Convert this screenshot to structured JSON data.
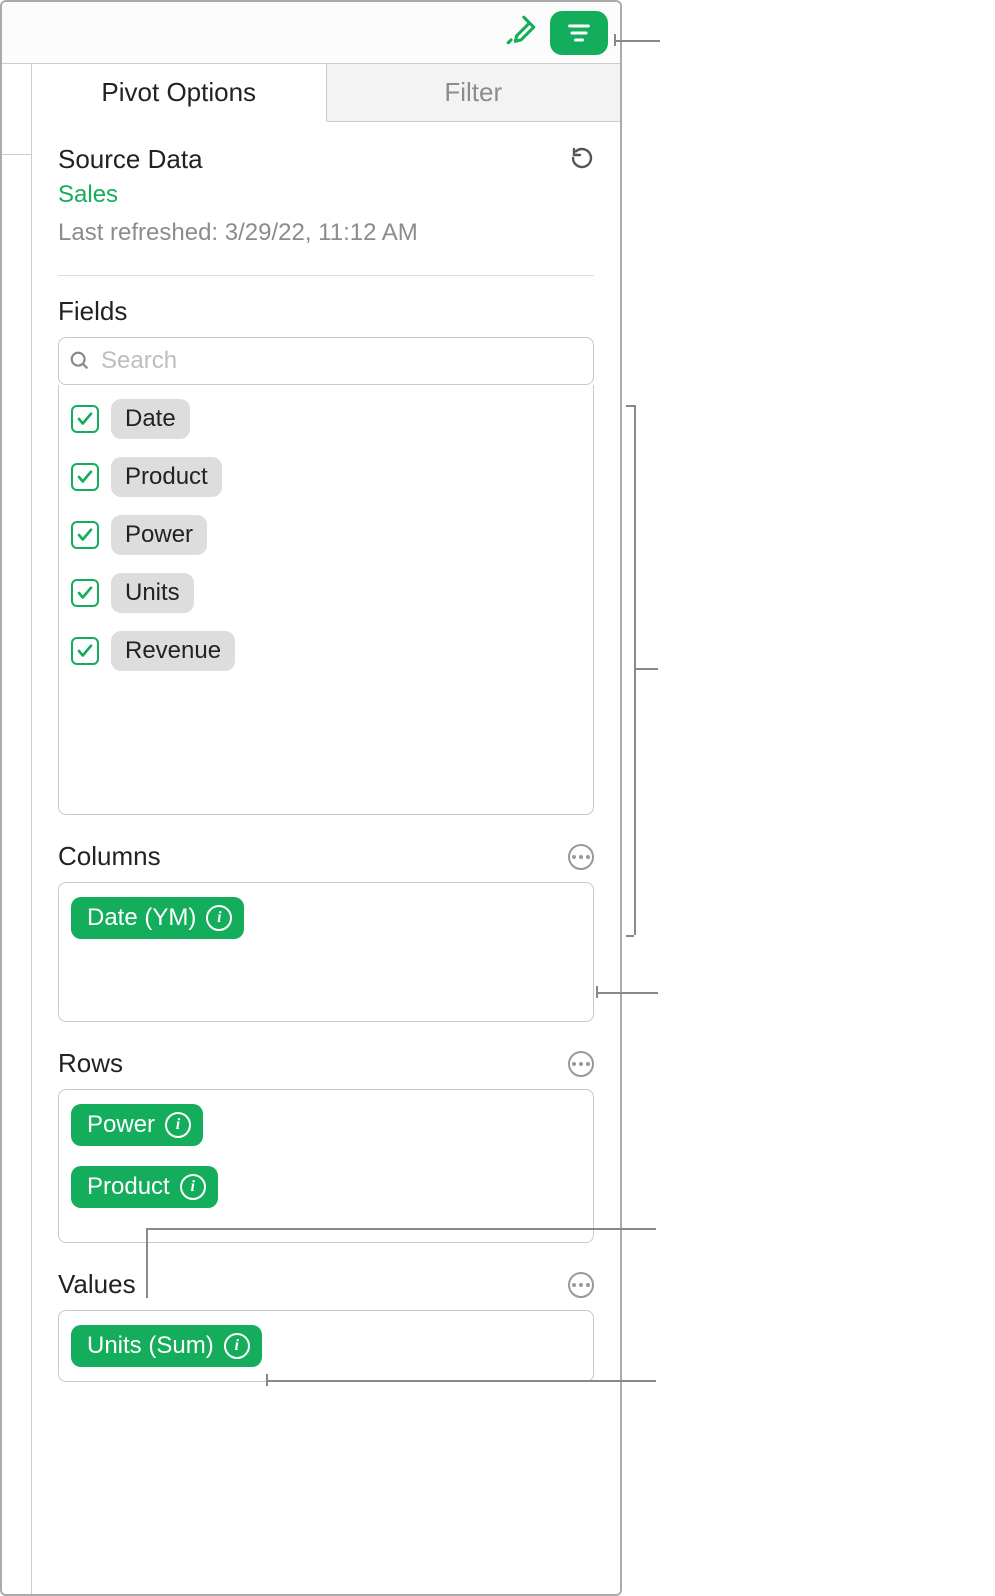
{
  "tabs": {
    "pivot": "Pivot Options",
    "filter": "Filter"
  },
  "source": {
    "heading": "Source Data",
    "name": "Sales",
    "refreshed": "Last refreshed: 3/29/22, 11:12 AM"
  },
  "fields": {
    "heading": "Fields",
    "search_placeholder": "Search",
    "items": [
      {
        "label": "Date",
        "checked": true
      },
      {
        "label": "Product",
        "checked": true
      },
      {
        "label": "Power",
        "checked": true
      },
      {
        "label": "Units",
        "checked": true
      },
      {
        "label": "Revenue",
        "checked": true
      }
    ]
  },
  "columns": {
    "heading": "Columns",
    "items": [
      {
        "label": "Date (YM)"
      }
    ]
  },
  "rows": {
    "heading": "Rows",
    "items": [
      {
        "label": "Power"
      },
      {
        "label": "Product"
      }
    ]
  },
  "values": {
    "heading": "Values",
    "items": [
      {
        "label": "Units (Sum)"
      }
    ]
  }
}
